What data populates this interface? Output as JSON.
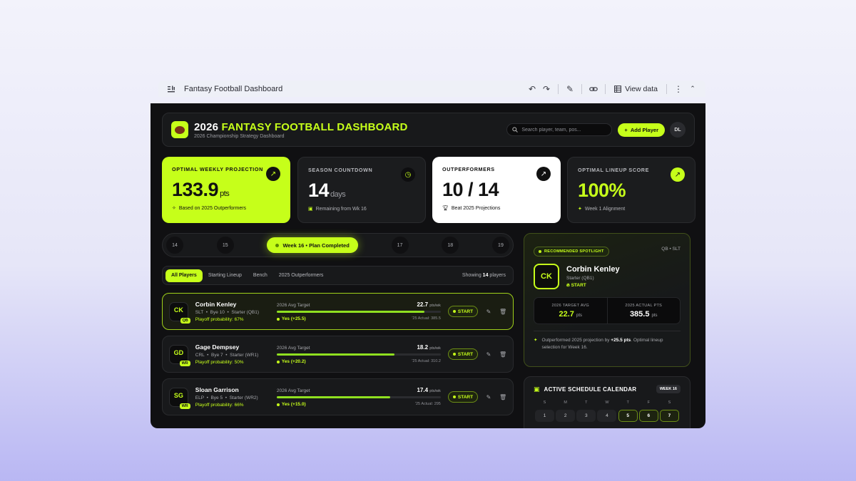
{
  "toolbar": {
    "title": "Fantasy Football Dashboard",
    "view_data_label": "View data"
  },
  "header": {
    "title_year": "2026",
    "title_main": "FANTASY FOOTBALL DASHBOARD",
    "subtitle": "2026 Championship Strategy Dashboard",
    "search_placeholder": "Search player, team, pos...",
    "add_player_label": "Add Player",
    "avatar_initials": "DL"
  },
  "kpis": [
    {
      "label": "OPTIMAL WEEKLY PROJECTION",
      "value": "133.9",
      "unit": "pts",
      "note": "Based on 2025 Outperformers"
    },
    {
      "label": "SEASON COUNTDOWN",
      "value": "14",
      "unit": "days",
      "note": "Remaining from Wk 16"
    },
    {
      "label": "OUTPERFORMERS",
      "value": "10 / 14",
      "unit": "",
      "note": "Beat 2025 Projections"
    },
    {
      "label": "OPTIMAL LINEUP SCORE",
      "value": "100%",
      "unit": "",
      "note": "Week 1 Alignment"
    }
  ],
  "weeks": {
    "items": [
      "14",
      "15",
      "17",
      "18",
      "19"
    ],
    "active_label": "Week 16 • Plan Completed"
  },
  "filters": {
    "tabs": [
      "All Players",
      "Starting Lineup",
      "Bench",
      "2025 Outperformers"
    ],
    "showing_prefix": "Showing",
    "showing_count": "14",
    "showing_suffix": "players"
  },
  "players": [
    {
      "initials": "CK",
      "pos": "QB",
      "name": "Corbin Kenley",
      "team": "SLT",
      "bye": "Bye 10",
      "role": "Starter (QB1)",
      "prob": "Playoff probability: 67%",
      "target_label": "2026 Avg Target",
      "target": "22.7",
      "unit": "pts/wk",
      "fill": 0.9,
      "delta": "Yes (+25.5)",
      "actual": "'25 Actual: 385.5",
      "action": "START"
    },
    {
      "initials": "GD",
      "pos": "WR",
      "name": "Gage Dempsey",
      "team": "CRL",
      "bye": "Bye 7",
      "role": "Starter (WR1)",
      "prob": "Playoff probability: 50%",
      "target_label": "2026 Avg Target",
      "target": "18.2",
      "unit": "pts/wk",
      "fill": 0.72,
      "delta": "Yes (+20.2)",
      "actual": "'25 Actual: 310.2",
      "action": "START"
    },
    {
      "initials": "SG",
      "pos": "WR",
      "name": "Sloan Garrison",
      "team": "ELP",
      "bye": "Bye 5",
      "role": "Starter (WR2)",
      "prob": "Playoff probability: 66%",
      "target_label": "2026 Avg Target",
      "target": "17.4",
      "unit": "pts/wk",
      "fill": 0.69,
      "delta": "Yes (+15.0)",
      "actual": "'25 Actual: 295",
      "action": "START"
    }
  ],
  "spotlight": {
    "badge": "RECOMMENDED SPOTLIGHT",
    "pos": "QB • SLT",
    "initials": "CK",
    "name": "Corbin Kenley",
    "role": "Starter (QB1)",
    "start": "START",
    "stat1_label": "2026 TARGET AVG",
    "stat1_value": "22.7",
    "stat1_unit": "pts",
    "stat2_label": "2025 ACTUAL PTS",
    "stat2_value": "385.5",
    "stat2_unit": "pts",
    "note_pre": "Outperformed 2025 projection by",
    "note_bold": "+25.5 pts",
    "note_post": ". Optimal lineup selection for Week 16."
  },
  "calendar": {
    "title": "ACTIVE SCHEDULE CALENDAR",
    "week_badge": "WEEK 16",
    "dows": [
      "S",
      "M",
      "T",
      "W",
      "T",
      "F",
      "S"
    ],
    "days": [
      "1",
      "2",
      "3",
      "4",
      "5",
      "6",
      "7"
    ]
  },
  "colors": {
    "accent": "#c6ff1a",
    "background": "#101012",
    "card": "#18191b"
  }
}
